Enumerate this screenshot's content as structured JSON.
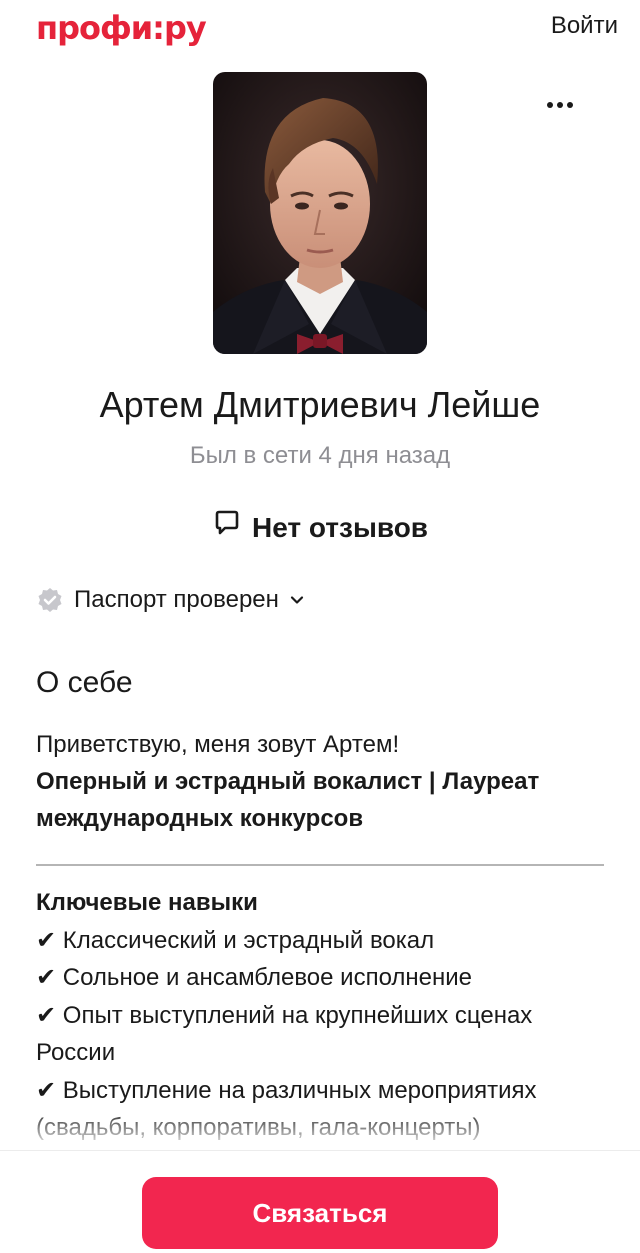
{
  "header": {
    "logo": "профи:ру",
    "login_label": "Войти"
  },
  "profile": {
    "photo_icon": "profile-photo",
    "menu_icon": "more-dots-icon",
    "name": "Артем Дмитриевич Лейше",
    "status": "Был в сети 4 дня назад",
    "reviews_icon": "chat-bubble-icon",
    "reviews": "Нет отзывов",
    "passport_icon": "verified-badge-icon",
    "passport": "Паспорт проверен",
    "passport_chevron_icon": "chevron-down-icon"
  },
  "about": {
    "title": "О себе",
    "greeting": "Приветствую, меня зовут Артем!",
    "headline": "Оперный и эстрадный вокалист | Лауреат международных конкурсов",
    "skills_title": "Ключевые навыки",
    "skills": [
      "✔ Классический и эстрадный вокал",
      "✔ Сольное и ансамблевое исполнение",
      "✔ Опыт выступлений на крупнейших сценах России",
      "✔ Выступление на различных мероприятиях (свадьбы, корпоративы, гала-концерты)"
    ]
  },
  "actions": {
    "contact_label": "Связаться"
  },
  "colors": {
    "brand": "#e5233a",
    "button": "#f2264f",
    "muted": "#8e8e93"
  }
}
